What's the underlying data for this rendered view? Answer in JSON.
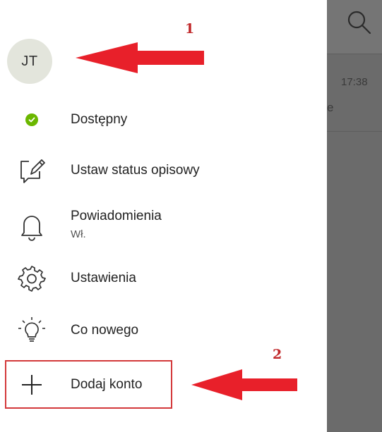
{
  "account": {
    "initials": "JT"
  },
  "menu": {
    "items": [
      {
        "id": "status",
        "label": "Dostępny"
      },
      {
        "id": "status-message",
        "label": "Ustaw status opisowy"
      },
      {
        "id": "notifications",
        "label": "Powiadomienia",
        "sub": "Wł."
      },
      {
        "id": "settings",
        "label": "Ustawienia"
      },
      {
        "id": "whats-new",
        "label": "Co nowego"
      },
      {
        "id": "add-account",
        "label": "Dodaj konto"
      }
    ]
  },
  "background": {
    "time": "17:38",
    "snippet": "e"
  },
  "annotations": {
    "one": "1",
    "two": "2"
  },
  "colors": {
    "status_green": "#6bb700",
    "annotation_red": "#d3383a"
  },
  "icons": [
    "search-icon",
    "status-available-icon",
    "edit-status-icon",
    "bell-icon",
    "gear-icon",
    "lightbulb-icon",
    "plus-icon"
  ]
}
